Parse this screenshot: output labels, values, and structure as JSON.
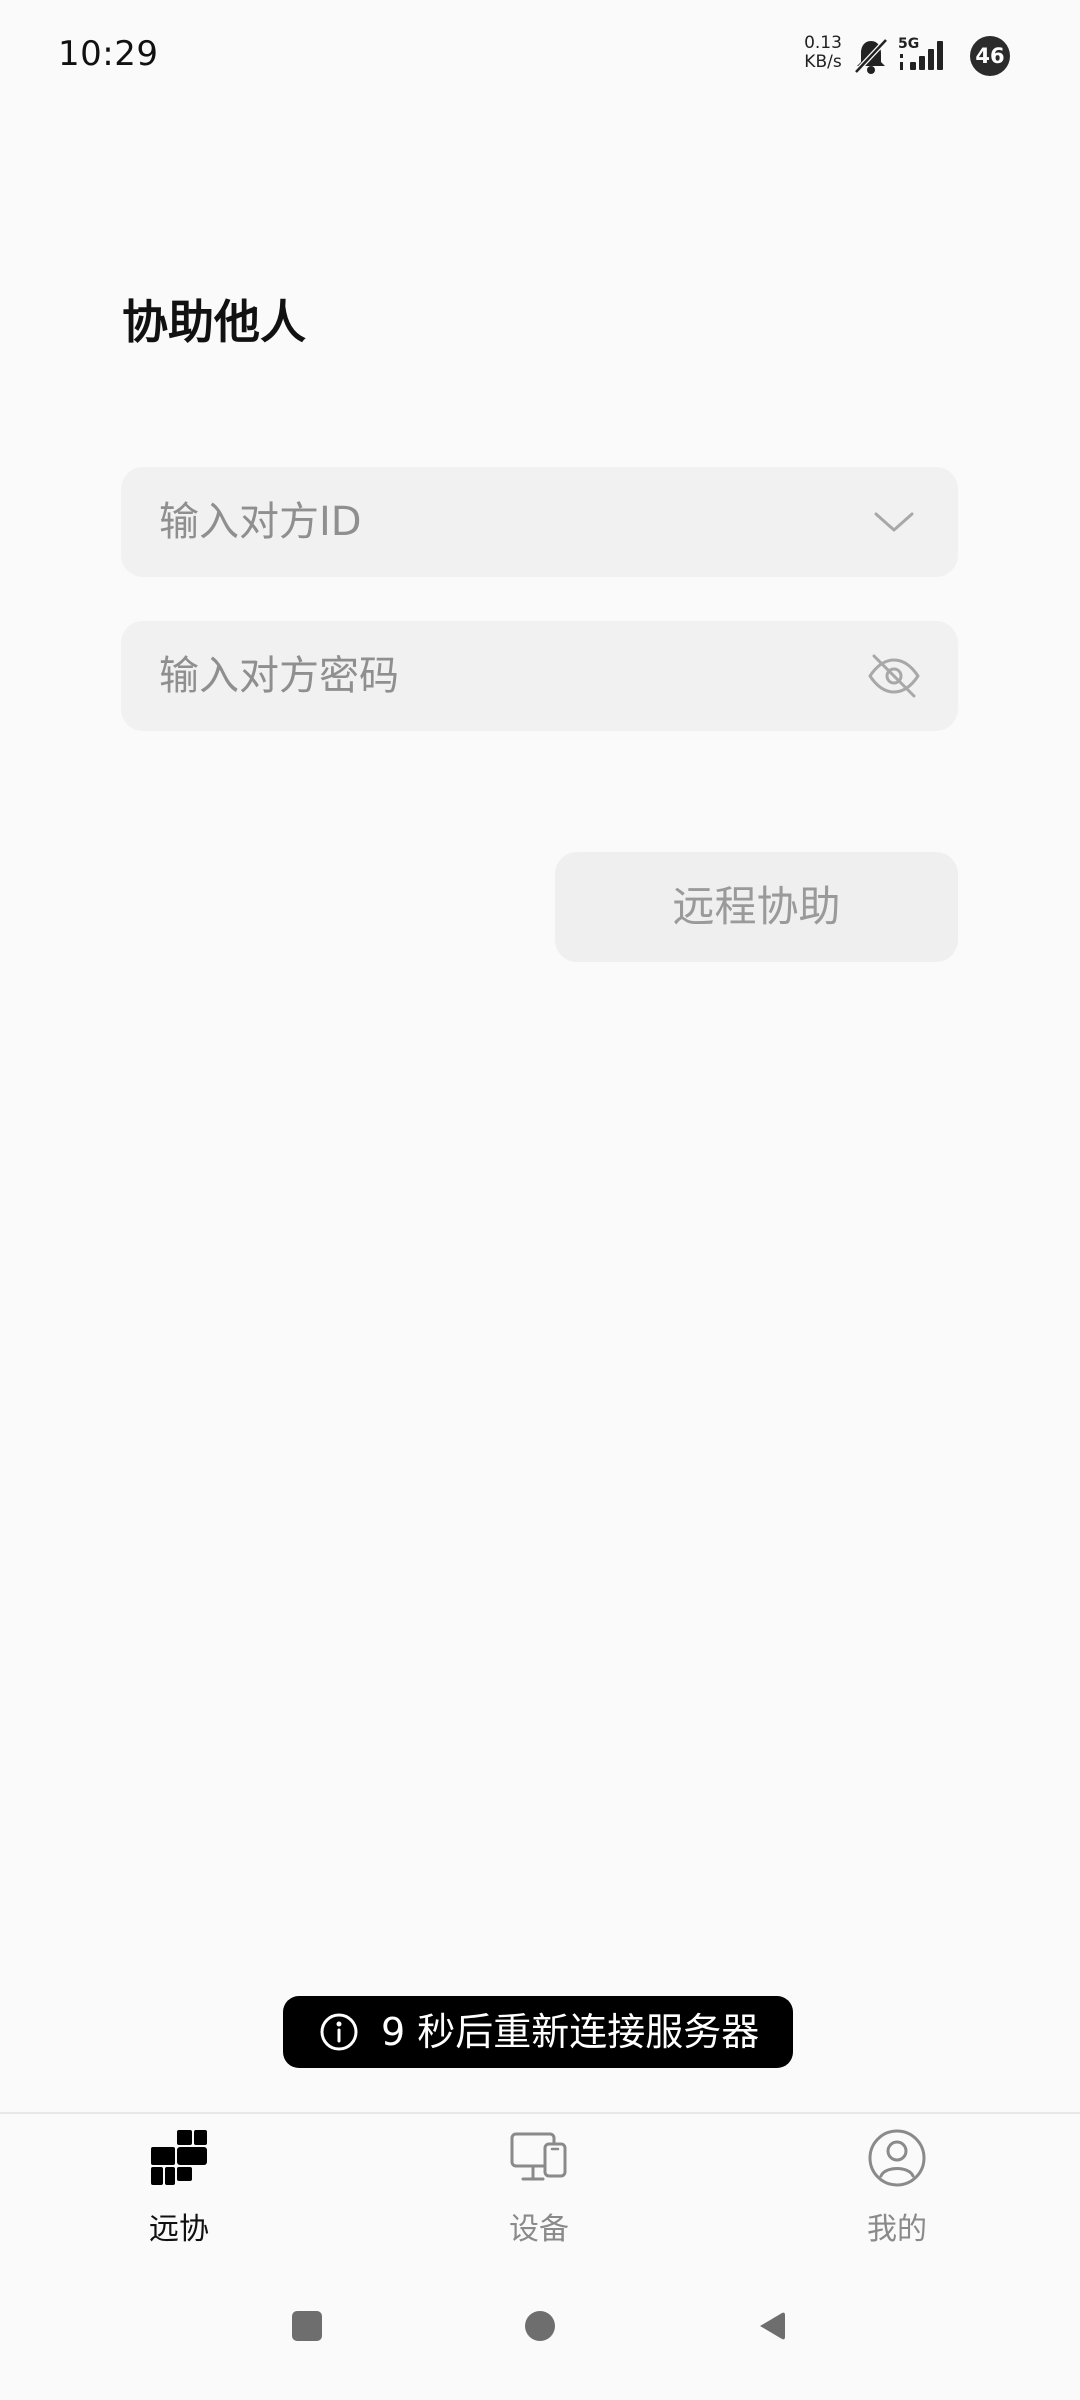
{
  "status_bar": {
    "time": "10:29",
    "net_speed_value": "0.13",
    "net_speed_unit": "KB/s",
    "network": "5G",
    "battery": "46",
    "icons": [
      "mute-icon",
      "signal-icon"
    ]
  },
  "page": {
    "title": "协助他人"
  },
  "form": {
    "id_placeholder": "输入对方ID",
    "id_value": "",
    "password_placeholder": "输入对方密码",
    "password_value": "",
    "submit_label": "远程协助"
  },
  "toast": {
    "icon": "info-icon",
    "message": "9 秒后重新连接服务器"
  },
  "tabs": [
    {
      "label": "远协",
      "icon": "remote-assist-icon",
      "active": true
    },
    {
      "label": "设备",
      "icon": "devices-icon",
      "active": false
    },
    {
      "label": "我的",
      "icon": "profile-icon",
      "active": false
    }
  ],
  "system_nav": {
    "buttons": [
      "recents-icon",
      "home-icon",
      "back-icon"
    ]
  },
  "colors": {
    "background": "#fafafa",
    "field_background": "#f1f1f1",
    "button_background": "#efefef",
    "toast_background": "#000000",
    "active_tab": "#111111",
    "inactive_tab": "#8a8a8a"
  }
}
